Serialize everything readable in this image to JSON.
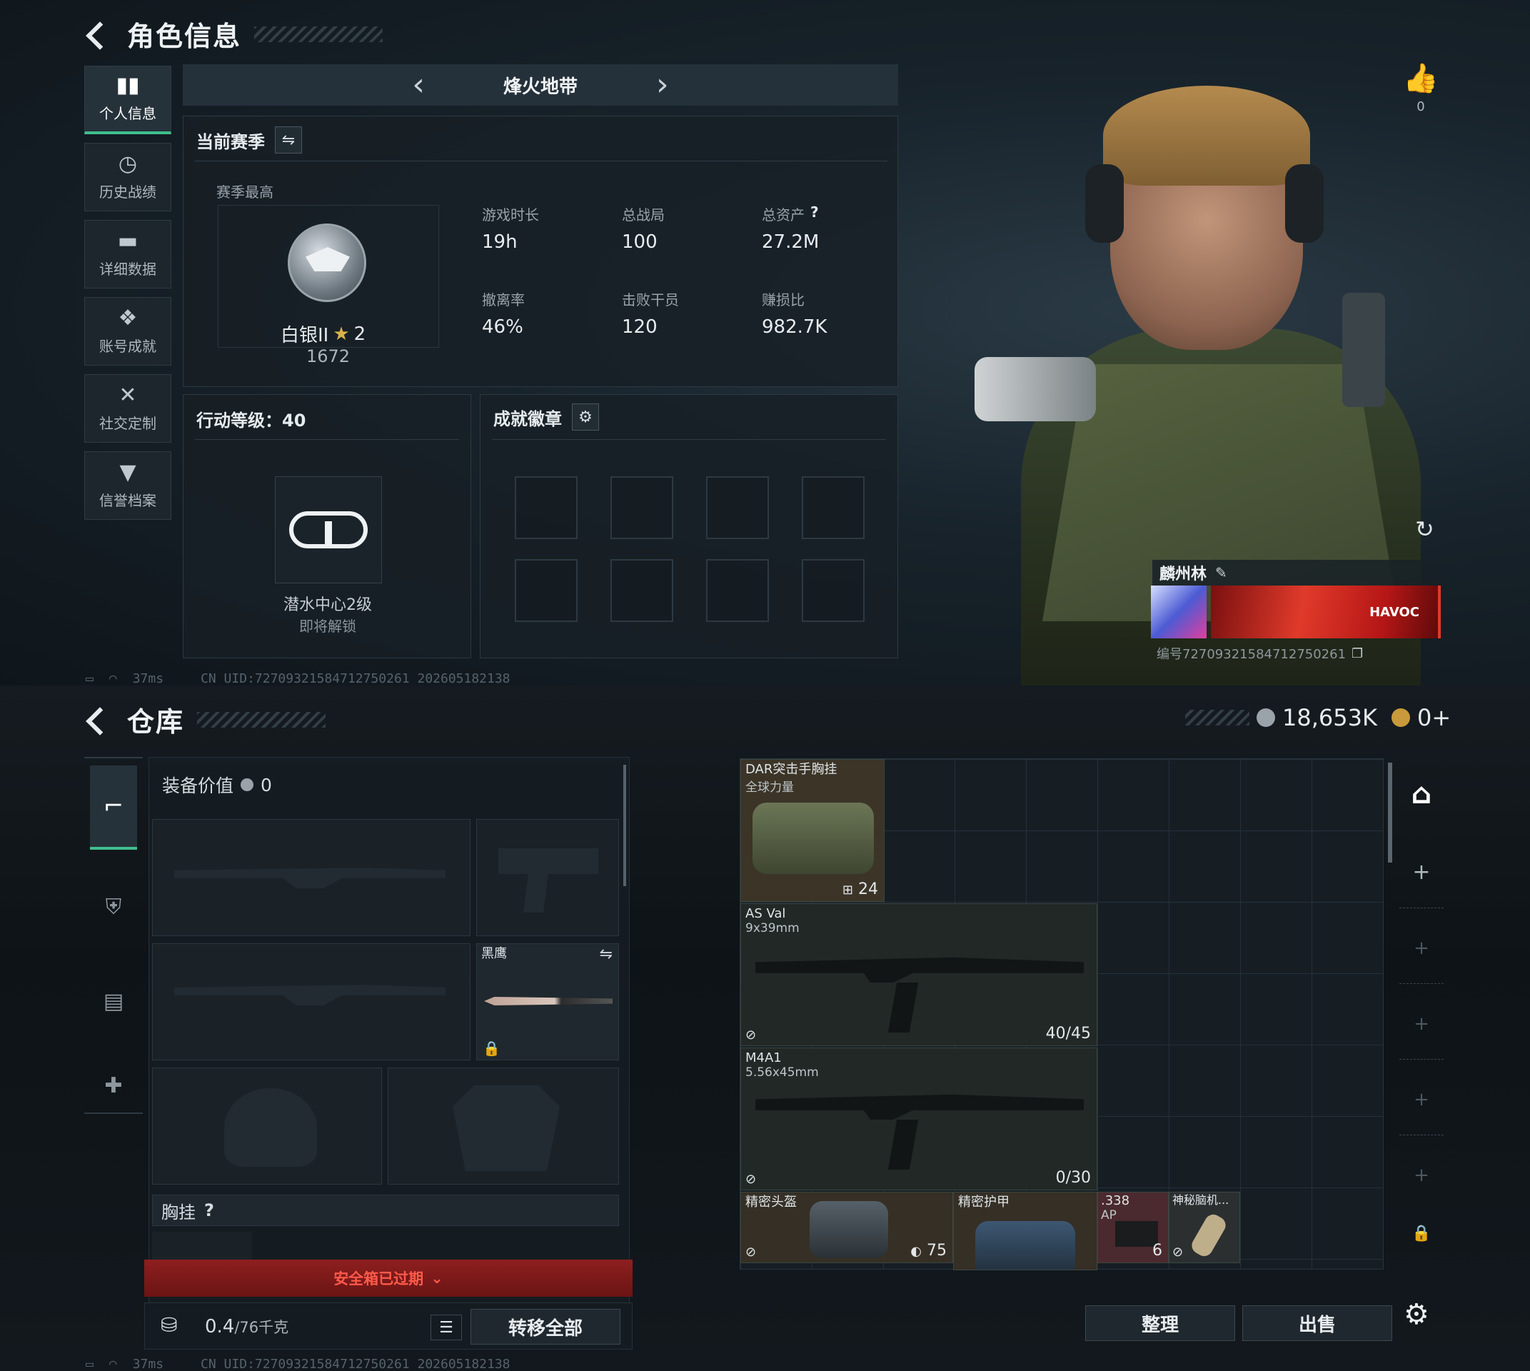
{
  "top": {
    "title": "角色信息",
    "sidebar": [
      {
        "label": "个人信息",
        "icon": "bar-chart-icon",
        "active": true
      },
      {
        "label": "历史战绩",
        "icon": "history-clock-icon"
      },
      {
        "label": "详细数据",
        "icon": "folder-icon"
      },
      {
        "label": "账号成就",
        "icon": "medal-icon"
      },
      {
        "label": "社交定制",
        "icon": "wrench-icon"
      },
      {
        "label": "信誉档案",
        "icon": "shield-icon"
      }
    ],
    "mode_selector": {
      "label": "烽火地带"
    },
    "season": {
      "title": "当前赛季",
      "best_label": "赛季最高",
      "rank_name": "白银II",
      "rank_stars": "2",
      "rank_score": "1672",
      "stats": [
        {
          "label": "游戏时长",
          "value": "19h"
        },
        {
          "label": "总战局",
          "value": "100"
        },
        {
          "label": "总资产",
          "value": "27.2M"
        },
        {
          "label": "撤离率",
          "value": "46%"
        },
        {
          "label": "击败干员",
          "value": "120"
        },
        {
          "label": "赚损比",
          "value": "982.7K"
        }
      ]
    },
    "action_level": {
      "title": "行动等级：40",
      "unlock_name": "潜水中心2级",
      "unlock_status": "即将解锁"
    },
    "achievements": {
      "title": "成就徽章"
    },
    "likes": {
      "count": "0"
    },
    "player": {
      "name": "麟州林",
      "card_text": "HAVOC",
      "id_text": "编号727093215847127502​61"
    },
    "status_bar": {
      "ping": "37ms",
      "uid": "CN UID:7270932158471275​0261 202605182138"
    }
  },
  "bottom": {
    "title": "仓库",
    "currency": {
      "money": "18,653K",
      "coins": "0+"
    },
    "loadout": {
      "equip_value_label": "装备价值",
      "equip_value": "0",
      "melee_name": "黑鹰",
      "chest_rig_label": "胸挂",
      "safe_box_label": "安全箱已过期",
      "weight": "0.4",
      "weight_max": "/76千克",
      "transfer_all_label": "转移全部"
    },
    "stash_items": [
      {
        "name": "DAR突击手胸挂",
        "sub": "全球力量",
        "count": "24"
      },
      {
        "name": "AS Val",
        "sub": "9x39mm",
        "count": "40/45"
      },
      {
        "name": "M4A1",
        "sub": "5.56x45mm",
        "count": "0/30"
      },
      {
        "name": "精密头盔",
        "sub": "",
        "count": "75"
      },
      {
        "name": "精密护甲",
        "sub": "",
        "count": ""
      },
      {
        "name": ".338",
        "sub": "AP",
        "count": "6"
      },
      {
        "name": "神秘脑机...",
        "sub": "",
        "count": ""
      }
    ],
    "buttons": {
      "sort_label": "整理",
      "sell_label": "出售"
    },
    "status_bar": {
      "ping": "37ms",
      "uid": "CN UID:7270932158471275​0261 202605182138"
    }
  },
  "colors": {
    "accent_green": "#3fbf8f",
    "danger_red": "#8e1f1f",
    "rank_star": "#d8b24a"
  }
}
